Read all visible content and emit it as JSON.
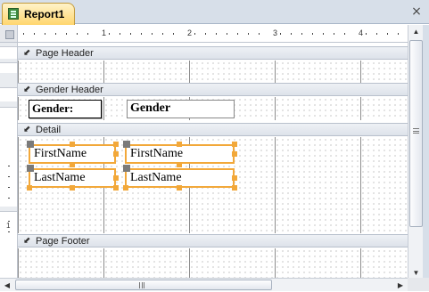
{
  "tab": {
    "title": "Report1",
    "icon": "report-icon"
  },
  "window": {
    "close_glyph": "×"
  },
  "ruler": {
    "labels": [
      "1",
      "2",
      "3",
      "4"
    ]
  },
  "sections": {
    "page_header": "Page Header",
    "group_header": "Gender Header",
    "detail": "Detail",
    "page_footer": "Page Footer"
  },
  "controls": {
    "gender_label": "Gender:",
    "gender_field": "Gender",
    "firstname_label": "FirstName",
    "firstname_field": "FirstName",
    "lastname_label": "LastName",
    "lastname_field": "LastName"
  },
  "vertical_ruler": {
    "label": "1"
  },
  "colors": {
    "selection": "#f2a83a",
    "tab_active": "#ffd66f"
  }
}
